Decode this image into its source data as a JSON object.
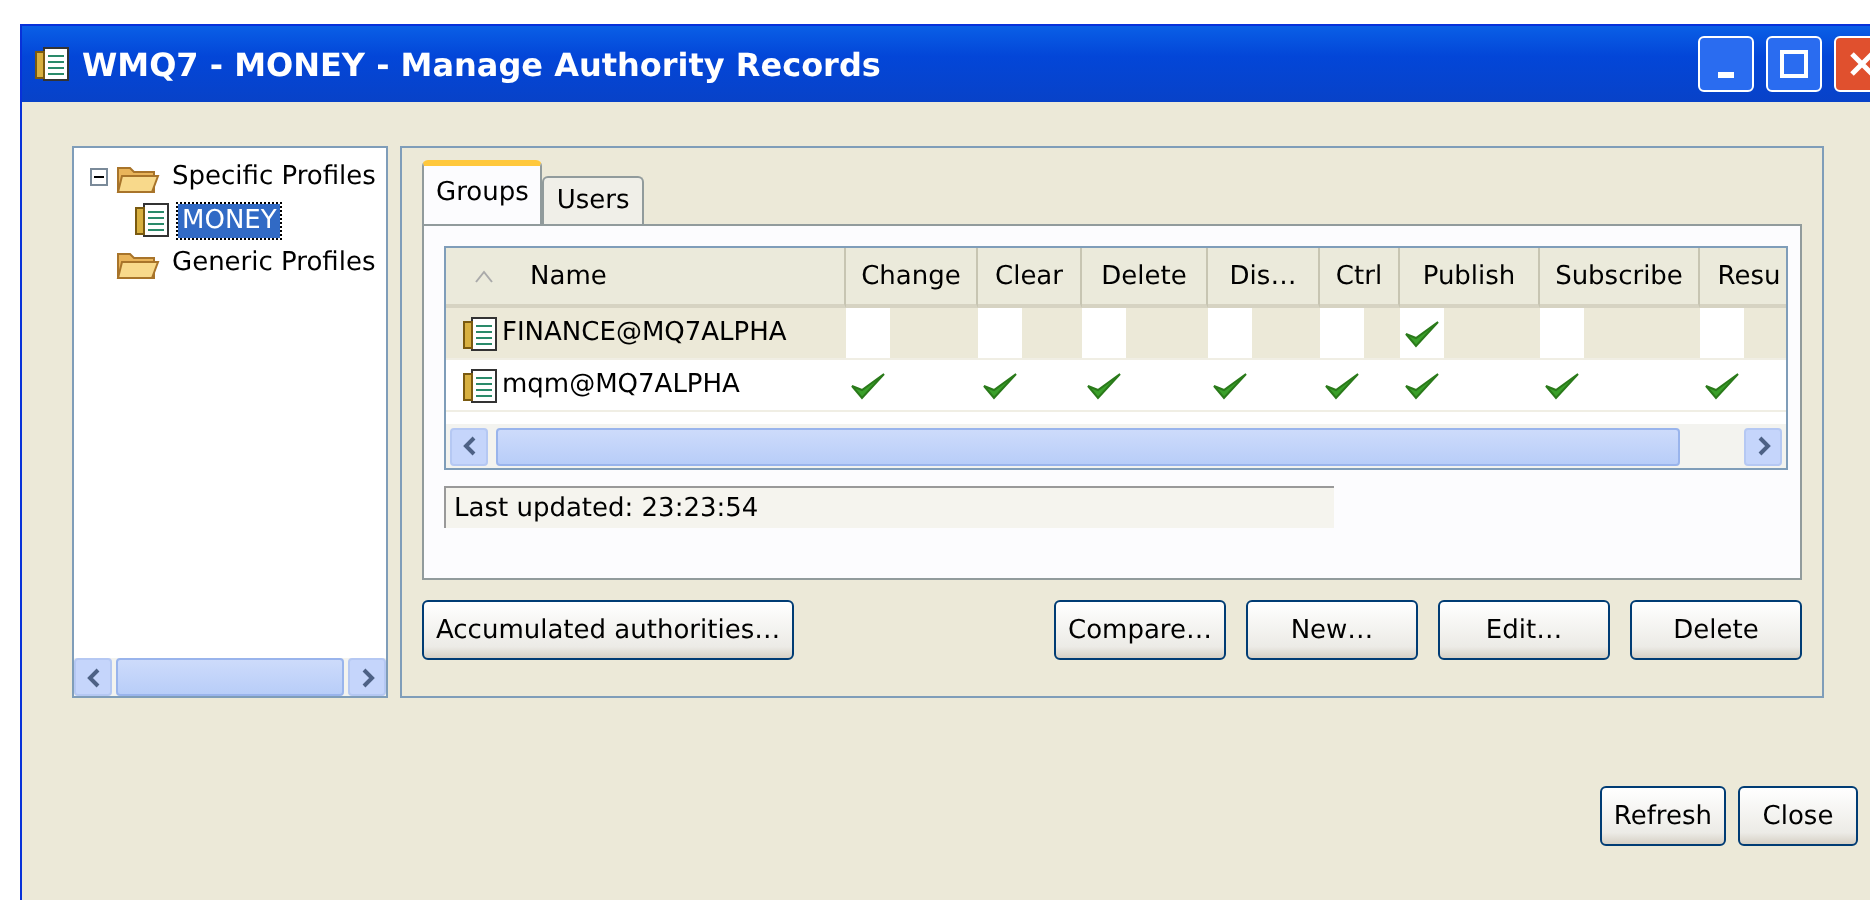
{
  "window": {
    "title": "WMQ7 - MONEY - Manage Authority Records"
  },
  "tree": [
    {
      "label": "Specific Profiles",
      "expanded": true,
      "selected": false,
      "children": [
        {
          "label": "MONEY",
          "selected": true
        }
      ]
    },
    {
      "label": "Generic Profiles",
      "selected": false
    }
  ],
  "tabs": [
    {
      "label": "Groups",
      "selected": true
    },
    {
      "label": "Users",
      "selected": false
    }
  ],
  "table": {
    "columns": [
      "Name",
      "Change",
      "Clear",
      "Delete",
      "Dis…",
      "Ctrl",
      "Publish",
      "Subscribe",
      "Resu"
    ],
    "rows": [
      {
        "name": "FINANCE@MQ7ALPHA",
        "selected": false,
        "checks": [
          false,
          false,
          false,
          false,
          false,
          true,
          false,
          false
        ]
      },
      {
        "name": "mqm@MQ7ALPHA",
        "selected": false,
        "checks": [
          true,
          true,
          true,
          true,
          true,
          true,
          true,
          true
        ]
      }
    ]
  },
  "status": "Last updated: 23:23:54",
  "panel_buttons": [
    "Accumulated authorities…",
    "Compare…",
    "New…",
    "Edit…",
    "Delete"
  ],
  "dialog_buttons": [
    "Refresh",
    "Close"
  ]
}
